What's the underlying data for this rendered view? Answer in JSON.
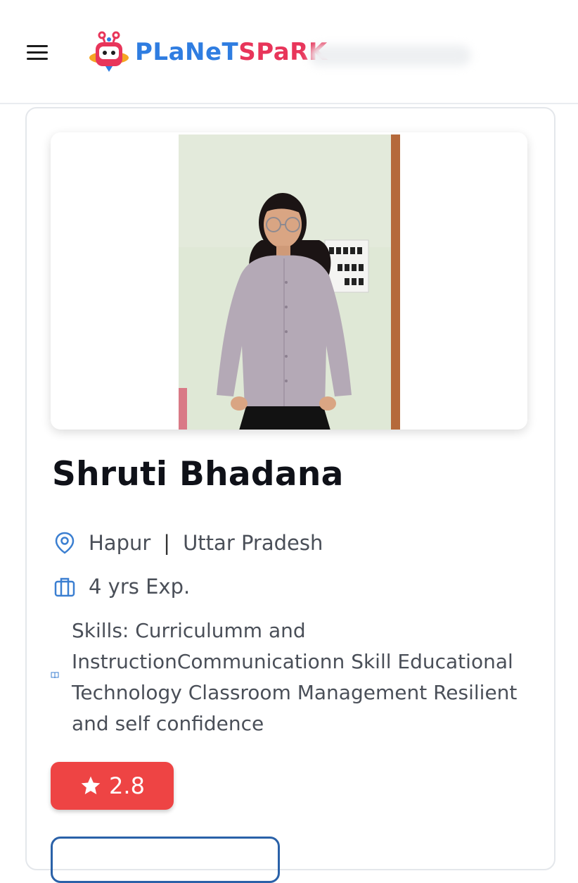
{
  "header": {
    "logo_text_part1": "PLaNeT",
    "logo_text_part2": "SPaRK"
  },
  "profile": {
    "name": "Shruti Bhadana",
    "city": "Hapur",
    "separator": "|",
    "state": "Uttar Pradesh",
    "experience": "4 yrs Exp.",
    "skills": "Skills: Curriculumm and InstructionCommunicationn Skill Educational Technology Classroom Management Resilient and self confidence",
    "rating": "2.8"
  },
  "colors": {
    "logo_blue": "#2f7de1",
    "logo_red": "#e8355a",
    "rating_bg": "#ee4444",
    "icon_blue": "#3b7fd1"
  },
  "icons": [
    "menu-icon",
    "planetspark-logo-icon",
    "location-pin-icon",
    "briefcase-icon",
    "book-icon",
    "star-icon"
  ]
}
